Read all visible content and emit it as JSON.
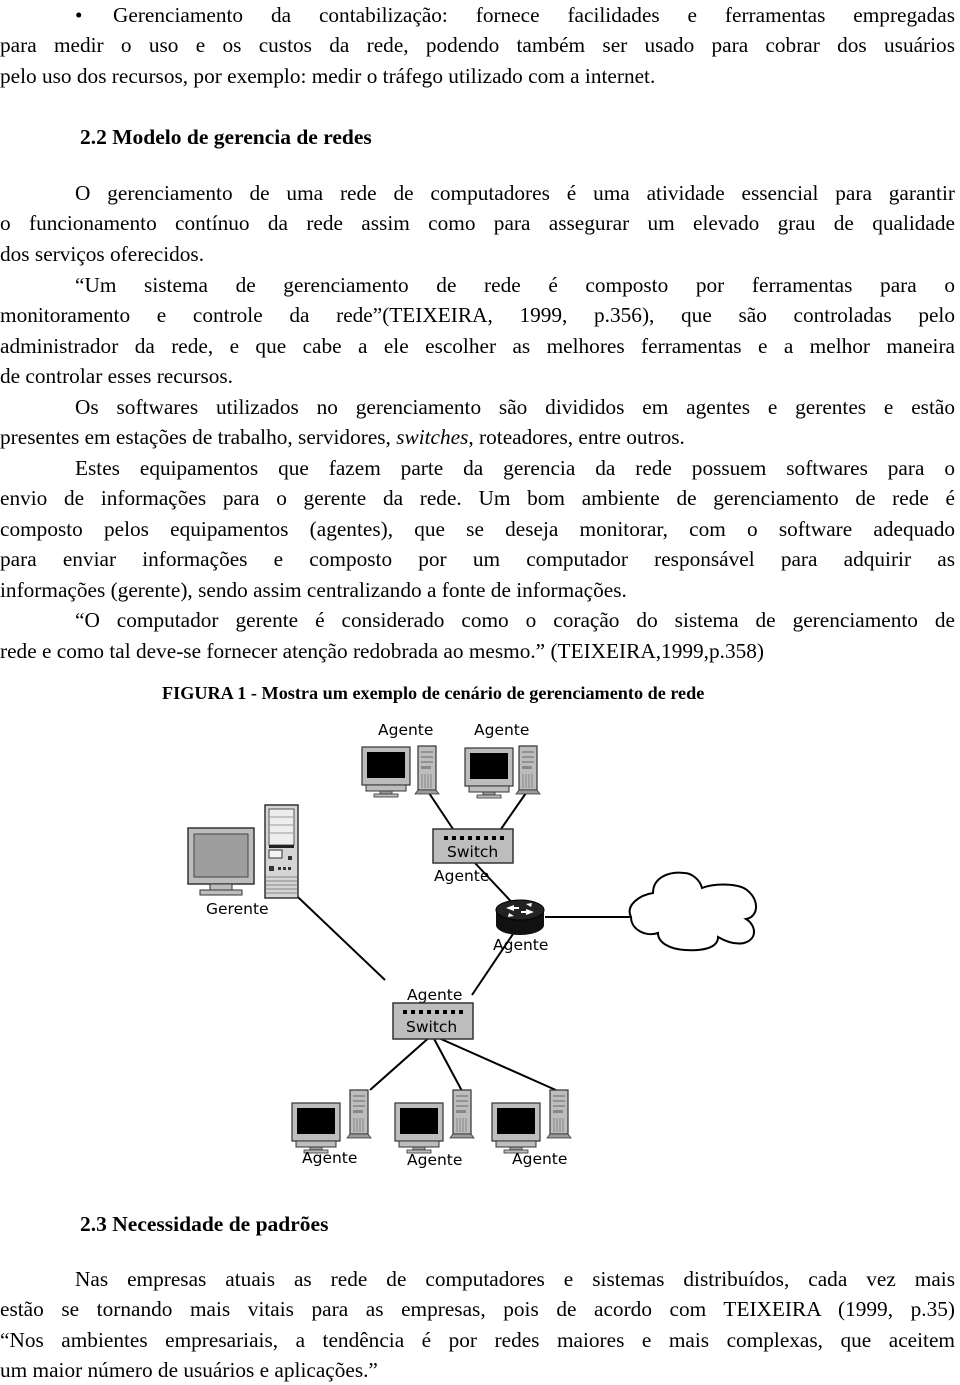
{
  "bullet_item": {
    "marker": "•",
    "lines": [
      "Gerenciamento da contabilização: fornece facilidades e ferramentas empregadas",
      "para medir o uso e os custos da rede, podendo também ser usado para cobrar dos usuários",
      "pelo uso dos recursos, por exemplo: medir o tráfego utilizado com a internet."
    ]
  },
  "section_2_2": {
    "heading": "2.2  Modelo de gerencia de redes",
    "paragraphs": [
      {
        "lines": [
          "O gerenciamento de uma rede de computadores é uma atividade essencial para garantir",
          "o funcionamento contínuo da rede assim como para assegurar um elevado grau de qualidade",
          "dos serviços oferecidos."
        ]
      },
      {
        "lines": [
          "“Um sistema de gerenciamento de rede é composto por ferramentas para o",
          "monitoramento e controle da rede”(TEIXEIRA, 1999, p.356), que são controladas pelo",
          "administrador da rede, e que cabe a ele escolher as melhores ferramentas e a melhor maneira",
          "de controlar esses recursos."
        ]
      },
      {
        "lines": [
          "Os softwares utilizados no gerenciamento são divididos em agentes e gerentes e estão",
          "presentes em estações de trabalho, servidores, ",
          "switches",
          ", roteadores, entre outros."
        ]
      },
      {
        "lines": [
          "Estes equipamentos que fazem parte da gerencia da rede possuem softwares para o",
          "envio de informações para o gerente da rede. Um bom ambiente de gerenciamento de rede é",
          "composto pelos equipamentos (agentes), que se deseja monitorar, com o software adequado",
          "para enviar informações e composto por um computador responsável para adquirir as",
          "informações (gerente), sendo assim centralizando a fonte de informações."
        ]
      },
      {
        "lines": [
          "“O computador gerente é considerado como o coração do sistema de gerenciamento de",
          "rede e como tal deve-se fornecer atenção redobrada ao mesmo.” (TEIXEIRA,1999,p.358)"
        ]
      }
    ]
  },
  "figure": {
    "caption": "FIGURA 1 - Mostra um exemplo de cenário de gerenciamento de rede",
    "labels": {
      "top_left_agent": "Agente",
      "top_right_agent": "Agente",
      "top_switch": "Switch",
      "top_switch_agent": "Agente",
      "manager": "Gerente",
      "router_agent": "Agente",
      "bottom_switch_agent": "Agente",
      "bottom_switch": "Switch",
      "bottom_agent_1": "Agente",
      "bottom_agent_2": "Agente",
      "bottom_agent_3": "Agente"
    }
  },
  "section_2_3": {
    "heading": "2.3  Necessidade de padrões",
    "paragraph_lines": [
      "Nas empresas atuais as rede de computadores e sistemas distribuídos, cada vez mais",
      "estão se tornando mais vitais para as empresas, pois de acordo com TEIXEIRA (1999, p.35)",
      "“Nos ambientes empresariais, a tendência é por redes maiores e mais complexas, que aceitem",
      "um maior número de usuários e aplicações.”"
    ]
  }
}
